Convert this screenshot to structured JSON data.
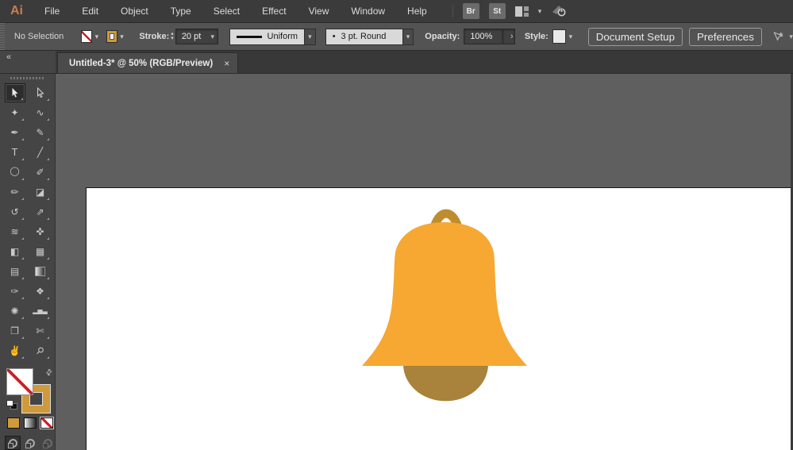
{
  "app": {
    "logo": "Ai"
  },
  "menubar": {
    "items": [
      "File",
      "Edit",
      "Object",
      "Type",
      "Select",
      "Effect",
      "View",
      "Window",
      "Help"
    ],
    "bridge_label": "Br",
    "stock_label": "St"
  },
  "controlbar": {
    "no_selection": "No Selection",
    "stroke_label": "Stroke:",
    "stroke_weight": "20 pt",
    "variable_width": "Uniform",
    "brush_bullet": "•",
    "brush": "3 pt. Round",
    "opacity_label": "Opacity:",
    "opacity_value": "100%",
    "style_label": "Style:",
    "document_setup_label": "Document Setup",
    "preferences_label": "Preferences"
  },
  "tab": {
    "title": "Untitled-3* @ 50% (RGB/Preview)"
  },
  "icons": {
    "chevron_down": "▾",
    "chevron_up": "▴",
    "chevron_right": "›",
    "close": "×",
    "collapse": "«",
    "swap": "⇄"
  },
  "panel": {
    "tools": [
      {
        "name": "selection",
        "glyph": ""
      },
      {
        "name": "direct-selection",
        "glyph": ""
      },
      {
        "name": "magic-wand",
        "glyph": "✦"
      },
      {
        "name": "lasso",
        "glyph": "∿"
      },
      {
        "name": "pen",
        "glyph": "✒"
      },
      {
        "name": "curvature",
        "glyph": "✎"
      },
      {
        "name": "type",
        "glyph": "T"
      },
      {
        "name": "line-segment",
        "glyph": "╱"
      },
      {
        "name": "ellipse",
        "glyph": "◯"
      },
      {
        "name": "paintbrush",
        "glyph": "✐"
      },
      {
        "name": "pencil",
        "glyph": "✏"
      },
      {
        "name": "eraser",
        "glyph": "◪"
      },
      {
        "name": "rotate",
        "glyph": "↺"
      },
      {
        "name": "scale",
        "glyph": "⇗"
      },
      {
        "name": "width",
        "glyph": "≋"
      },
      {
        "name": "puppet-warp",
        "glyph": "✜"
      },
      {
        "name": "shape-builder",
        "glyph": "◧"
      },
      {
        "name": "perspective-grid",
        "glyph": "▦"
      },
      {
        "name": "mesh",
        "glyph": "▤"
      },
      {
        "name": "gradient",
        "glyph": ""
      },
      {
        "name": "eyedropper",
        "glyph": "✑"
      },
      {
        "name": "blend",
        "glyph": "❖"
      },
      {
        "name": "symbol-sprayer",
        "glyph": "✺"
      },
      {
        "name": "column-graph",
        "glyph": "▂▅▃"
      },
      {
        "name": "artboard",
        "glyph": "❐"
      },
      {
        "name": "slice",
        "glyph": "✄"
      },
      {
        "name": "hand",
        "glyph": "✌"
      },
      {
        "name": "zoom",
        "glyph": "⚲"
      }
    ]
  },
  "colors": {
    "menubar_bg": "#3B3B3B",
    "controlbar_bg": "#535353",
    "panel_bg": "#454545",
    "canvas_bg": "#5F5F5F",
    "artboard": "#FFFFFF",
    "logo_orange": "#C97F4E",
    "swatch_gold": "#CE9A3B",
    "none_red": "#CC2027"
  },
  "canvas": {
    "bell": {
      "body": "#F6A832",
      "handle": "#BF8C2E",
      "clapper": "#A9823B"
    }
  }
}
